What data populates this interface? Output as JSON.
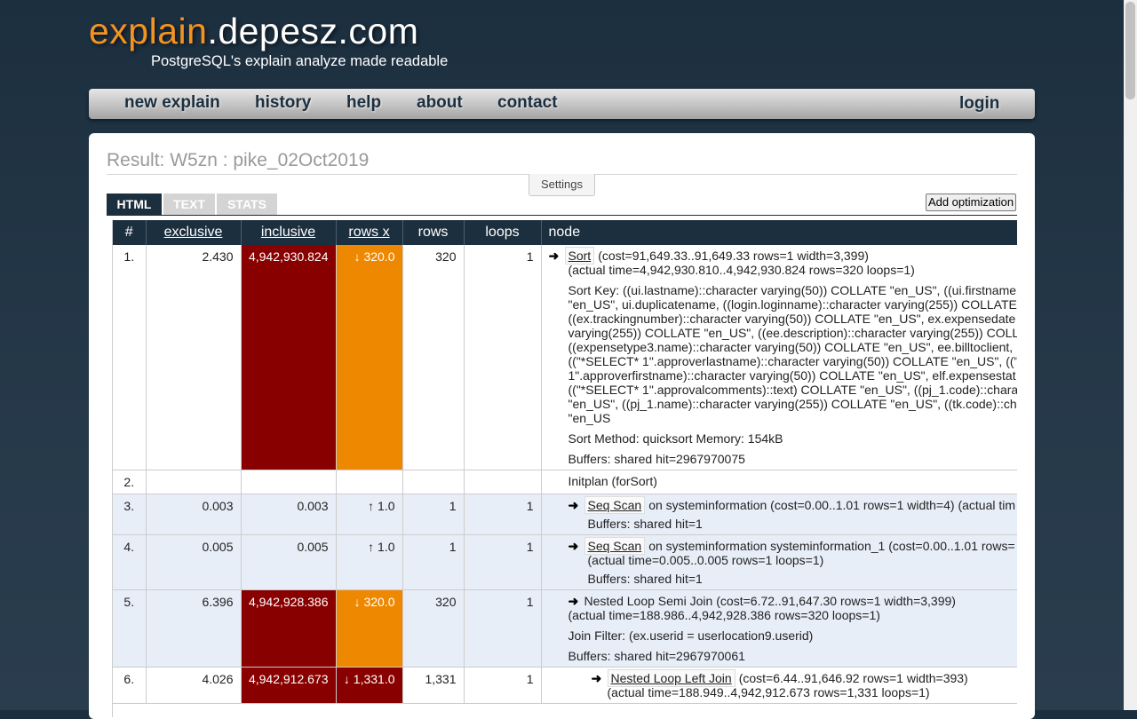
{
  "site": {
    "logo_part1": "explain",
    "logo_part2": ".depesz.com",
    "tagline": "PostgreSQL's explain analyze made readable",
    "accent": "#f39322",
    "bg": "#1c2f3f"
  },
  "nav": {
    "new_explain": "new explain",
    "history": "history",
    "help": "help",
    "about": "about",
    "contact": "contact",
    "login": "login"
  },
  "result": {
    "title": "Result: W5zn : pike_02Oct2019",
    "settings": "Settings",
    "add_optimization": "Add optimization",
    "tabs": [
      "HTML",
      "TEXT",
      "STATS"
    ]
  },
  "table": {
    "headers": [
      "#",
      "exclusive",
      "inclusive",
      "rows x",
      "rows",
      "loops",
      "node"
    ],
    "rows": [
      {
        "n": "1.",
        "exclusive": "2.430",
        "inclusive": "4,942,930.824",
        "rows_x": "↓ 320.0",
        "rows": "320",
        "loops": "1",
        "node_name": "Sort",
        "node_rest": "(cost=91,649.33..91,649.33 rows=1 width=3,399)",
        "node_line2": "(actual time=4,942,930.810..4,942,930.824 rows=320 loops=1)",
        "sort_key": [
          "Sort Key: ((ui.lastname)::character varying(50)) COLLATE \"en_US\", ((ui.firstname",
          "\"en_US\", ui.duplicatename, ((login.loginname)::character varying(255)) COLLATE",
          "((ex.trackingnumber)::character varying(50)) COLLATE \"en_US\", ex.expensedate",
          "varying(255)) COLLATE \"en_US\", ((ee.description)::character varying(255)) COLL",
          "((expensetype3.name)::character varying(50)) COLLATE \"en_US\", ee.billtoclient,",
          "((\"*SELECT* 1\".approverlastname)::character varying(50)) COLLATE \"en_US\", ((\"",
          "1\".approverfirstname)::character varying(50)) COLLATE \"en_US\", elf.expensestat",
          "((\"*SELECT* 1\".approvalcomments)::text) COLLATE \"en_US\", ((pj_1.code)::chara",
          "\"en_US\", ((pj_1.name)::character varying(255)) COLLATE \"en_US\", ((tk.code)::ch",
          "\"en_US"
        ],
        "sort_method": "Sort Method: quicksort Memory: 154kB",
        "buffers": "Buffers: shared hit=2967970075"
      },
      {
        "n": "2.",
        "initplan": "Initplan (forSort)"
      },
      {
        "n": "3.",
        "exclusive": "0.003",
        "inclusive": "0.003",
        "rows_x": "↑ 1.0",
        "rows": "1",
        "loops": "1",
        "node_name": "Seq Scan",
        "node_rest": "on systeminformation (cost=0.00..1.01 rows=1 width=4) (actual tim",
        "buffers": "Buffers: shared hit=1"
      },
      {
        "n": "4.",
        "exclusive": "0.005",
        "inclusive": "0.005",
        "rows_x": "↑ 1.0",
        "rows": "1",
        "loops": "1",
        "node_name": "Seq Scan",
        "node_rest": "on systeminformation systeminformation_1 (cost=0.00..1.01 rows=",
        "node_line2": "(actual time=0.005..0.005 rows=1 loops=1)",
        "buffers": "Buffers: shared hit=1"
      },
      {
        "n": "5.",
        "exclusive": "6.396",
        "inclusive": "4,942,928.386",
        "rows_x": "↓ 320.0",
        "rows": "320",
        "loops": "1",
        "node_name": "Nested Loop Semi Join",
        "node_rest": "(cost=6.72..91,647.30 rows=1 width=3,399)",
        "node_line2": "(actual time=188.986..4,942,928.386 rows=320 loops=1)",
        "join_filter": "Join Filter: (ex.userid = userlocation9.userid)",
        "buffers": "Buffers: shared hit=2967970061"
      },
      {
        "n": "6.",
        "exclusive": "4.026",
        "inclusive": "4,942,912.673",
        "rows_x": "↓ 1,331.0",
        "rows": "1,331",
        "loops": "1",
        "node_name": "Nested Loop Left Join",
        "node_rest": "(cost=6.44..91,646.92 rows=1 width=393)",
        "node_line2": "(actual time=188.949..4,942,912.673 rows=1,331 loops=1)"
      }
    ]
  }
}
